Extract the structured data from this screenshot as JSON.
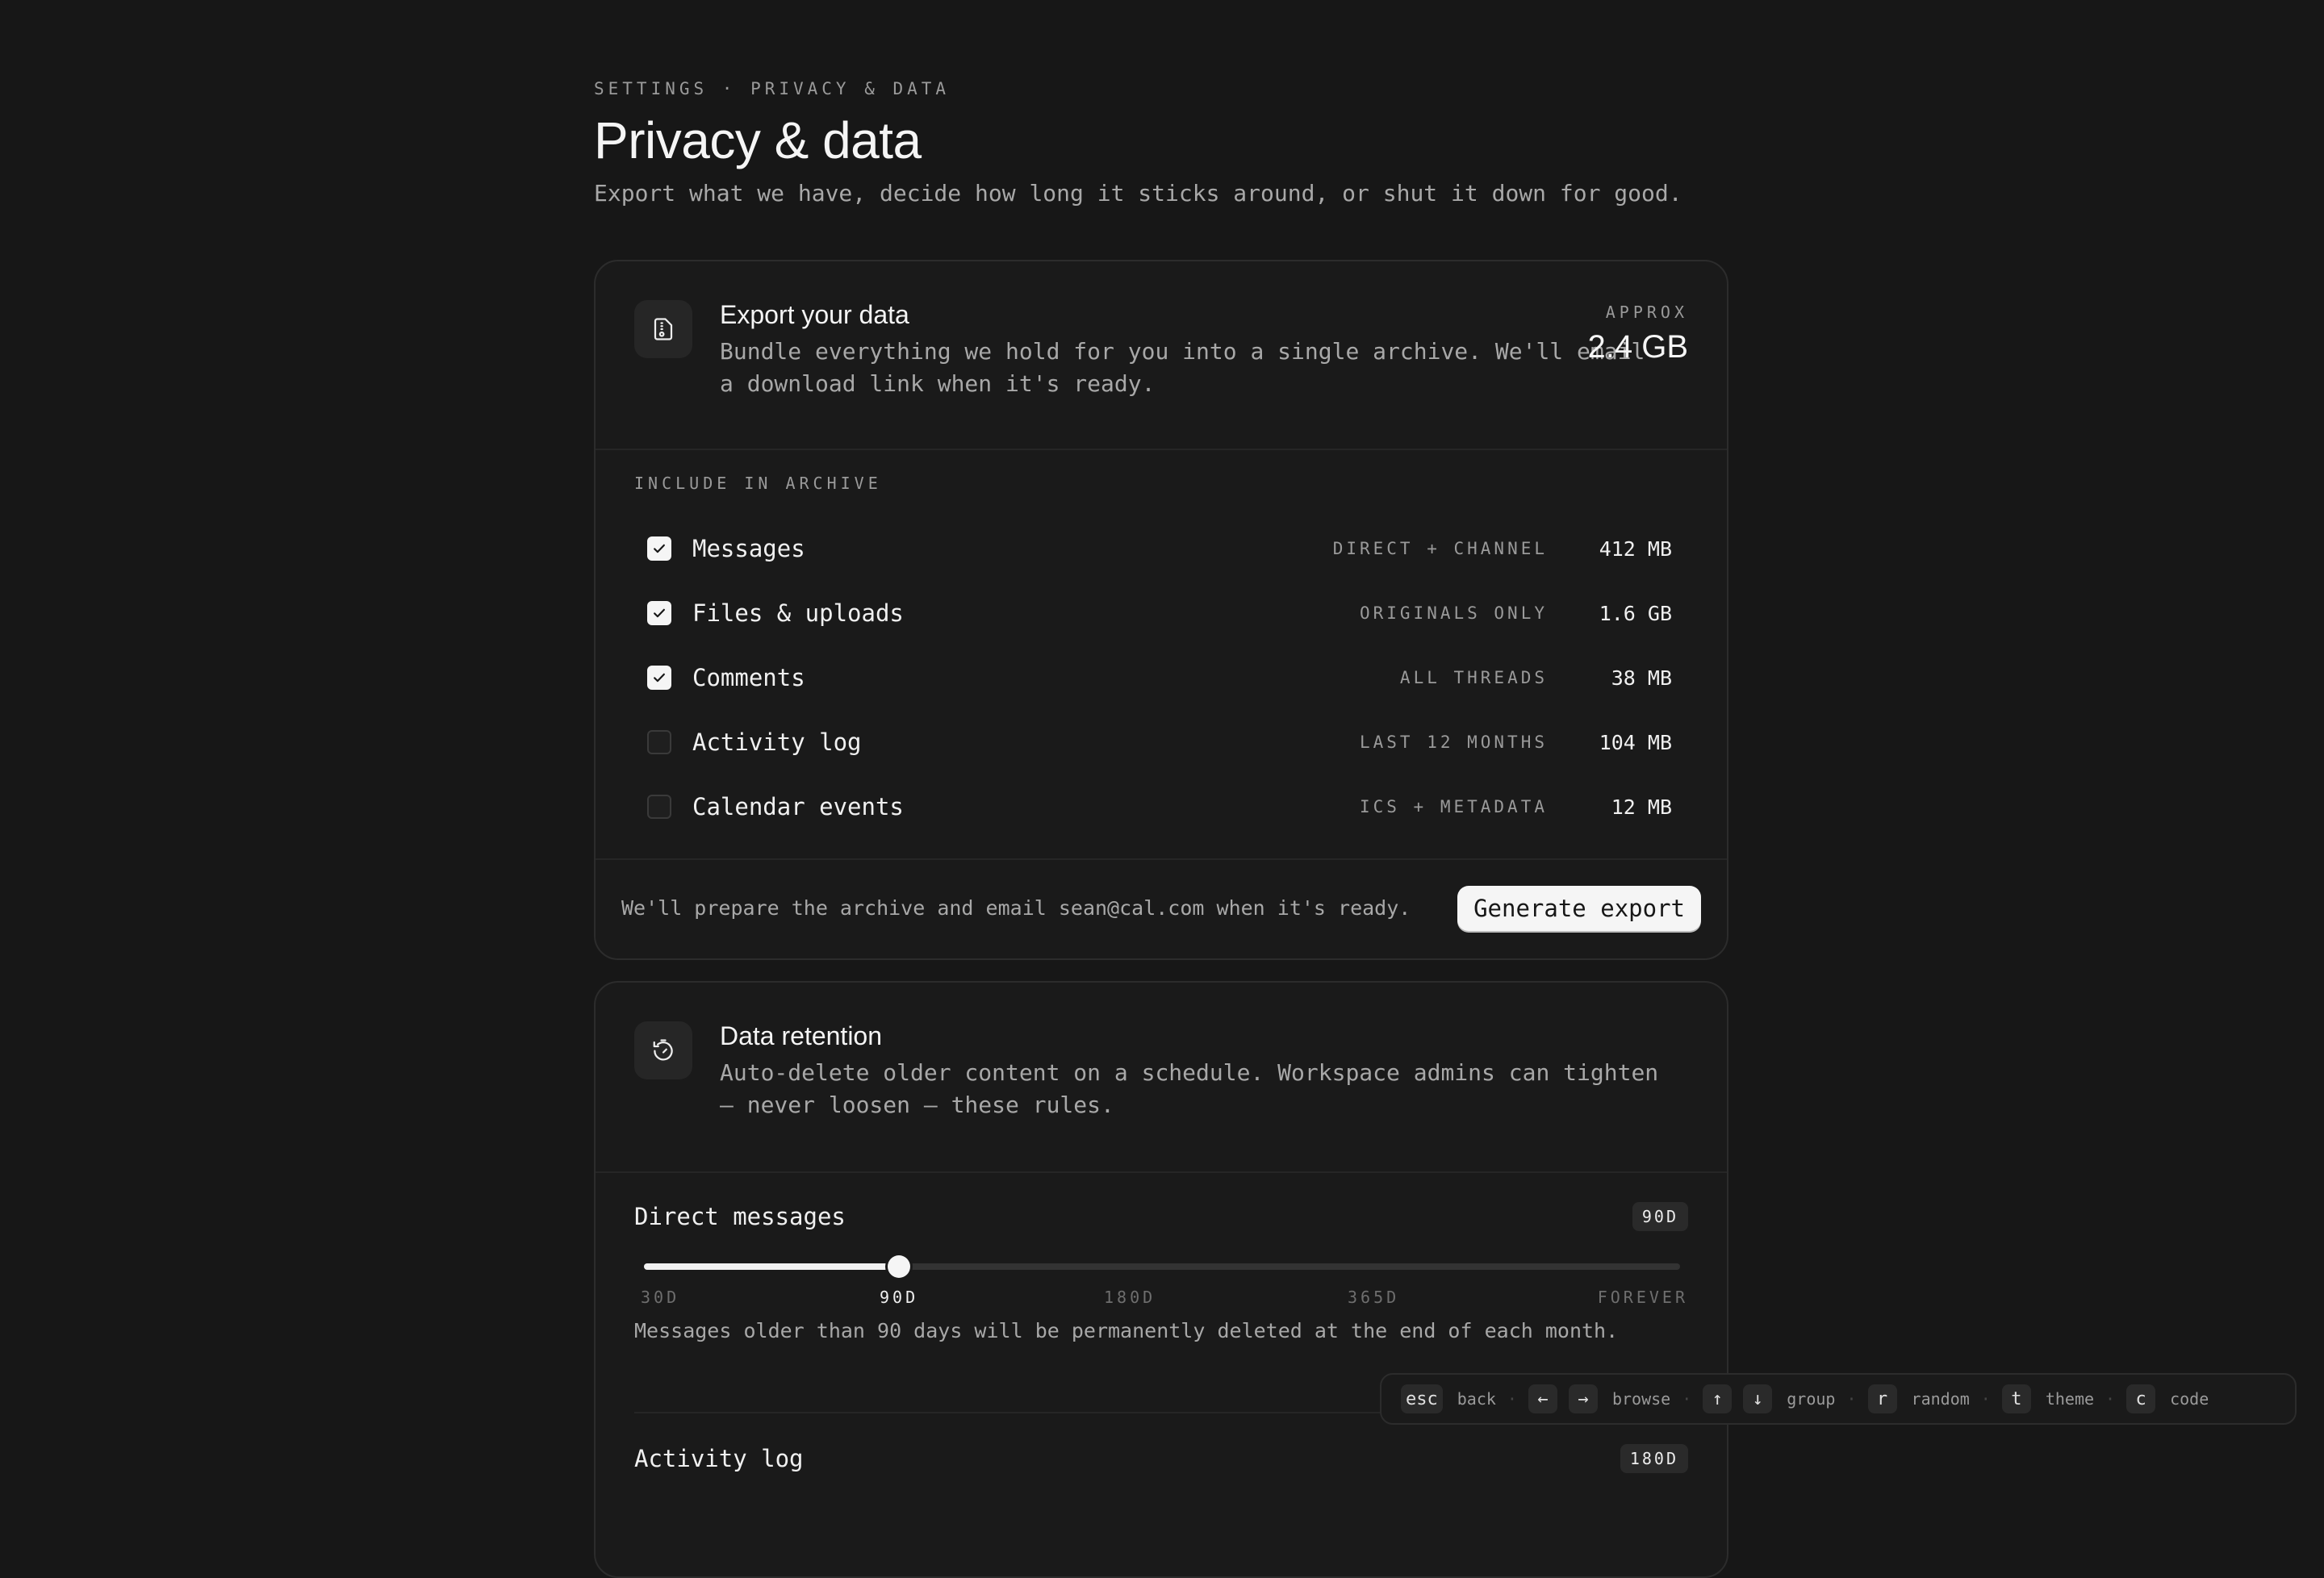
{
  "header": {
    "breadcrumb": "SETTINGS · PRIVACY & DATA",
    "title": "Privacy & data",
    "subtitle": "Export what we have, decide how long it sticks around, or shut it down for good."
  },
  "export_card": {
    "icon": "file-archive-icon",
    "title": "Export your data",
    "description": "Bundle everything we hold for you into a single archive. We'll email a download link when it's ready.",
    "approx_label": "APPROX",
    "approx_value": "2.4 GB",
    "section_label": "INCLUDE IN ARCHIVE",
    "items": [
      {
        "label": "Messages",
        "scope": "DIRECT + CHANNEL",
        "size": "412 MB",
        "checked": true
      },
      {
        "label": "Files & uploads",
        "scope": "ORIGINALS ONLY",
        "size": "1.6 GB",
        "checked": true
      },
      {
        "label": "Comments",
        "scope": "ALL THREADS",
        "size": "38 MB",
        "checked": true
      },
      {
        "label": "Activity log",
        "scope": "LAST 12 MONTHS",
        "size": "104 MB",
        "checked": false
      },
      {
        "label": "Calendar events",
        "scope": "ICS + METADATA",
        "size": "12 MB",
        "checked": false
      }
    ],
    "footer_text": "We'll prepare the archive and email sean@cal.com when it's ready.",
    "button_label": "Generate export"
  },
  "retention_card": {
    "icon": "timer-reset-icon",
    "title": "Data retention",
    "description": "Auto-delete older content on a schedule. Workspace admins can tighten — never loosen — these rules.",
    "direct_messages": {
      "label": "Direct messages",
      "badge": "90D",
      "ticks": [
        "30D",
        "90D",
        "180D",
        "365D",
        "FOREVER"
      ],
      "selected_index": 1,
      "note": "Messages older than 90 days will be permanently deleted at the end of each month."
    },
    "activity_log": {
      "label": "Activity log",
      "badge": "180D"
    }
  },
  "shortcuts": [
    {
      "keys": [
        "esc"
      ],
      "label": "back"
    },
    {
      "keys": [
        "←",
        "→"
      ],
      "label": "browse"
    },
    {
      "keys": [
        "↑",
        "↓"
      ],
      "label": "group"
    },
    {
      "keys": [
        "r"
      ],
      "label": "random"
    },
    {
      "keys": [
        "t"
      ],
      "label": "theme"
    },
    {
      "keys": [
        "c"
      ],
      "label": "code"
    }
  ]
}
